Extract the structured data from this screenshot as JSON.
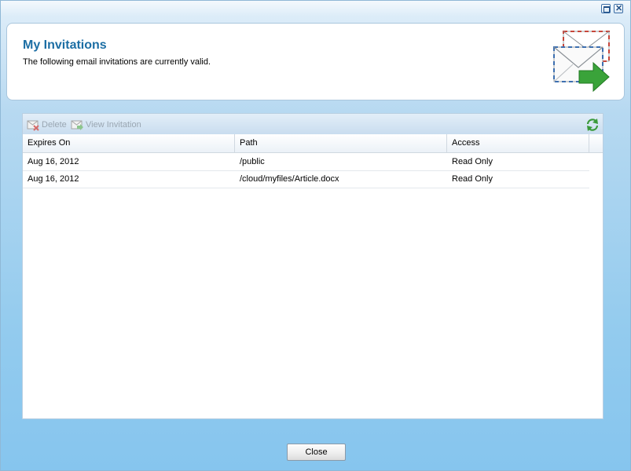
{
  "window": {
    "maximize_icon": "maximize-icon",
    "close_icon": "close-icon"
  },
  "header": {
    "title": "My Invitations",
    "subtitle": "The following email invitations are currently valid.",
    "icon": "email-invitation-icon",
    "title_color": "#1c6ea4"
  },
  "toolbar": {
    "delete_label": "Delete",
    "view_label": "View Invitation",
    "refresh_icon": "refresh-icon"
  },
  "table": {
    "columns": [
      "Expires On",
      "Path",
      "Access"
    ],
    "rows": [
      [
        "Aug 16, 2012",
        "/public",
        "Read Only"
      ],
      [
        "Aug 16, 2012",
        "/cloud/myfiles/Article.docx",
        "Read Only"
      ]
    ]
  },
  "footer": {
    "close_label": "Close"
  }
}
